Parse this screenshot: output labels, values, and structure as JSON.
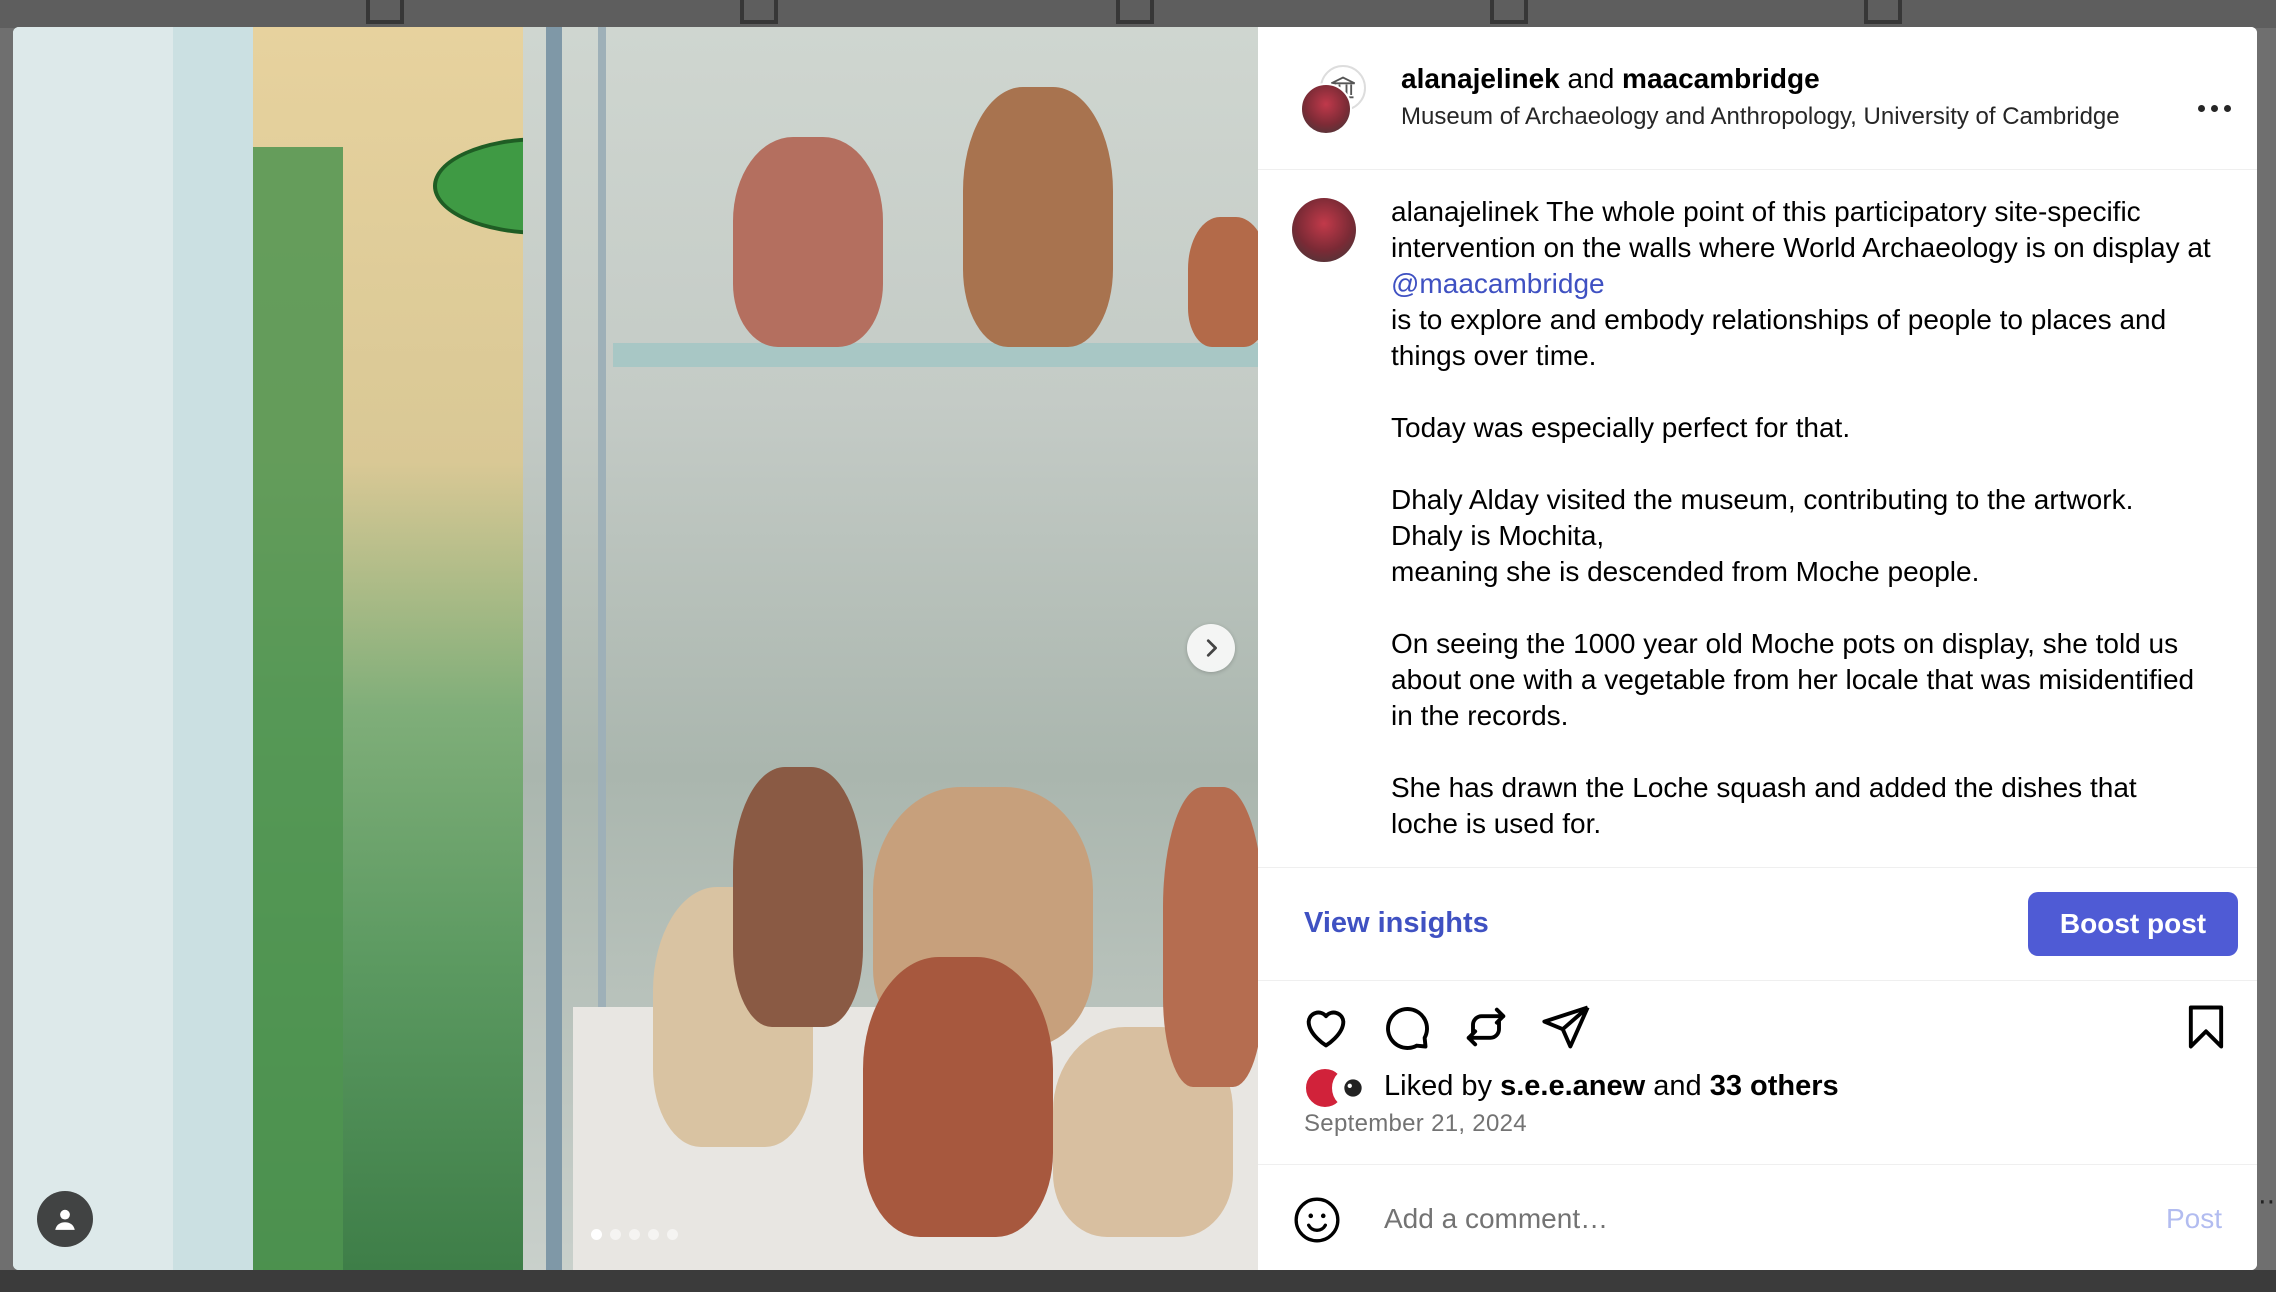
{
  "post": {
    "header": {
      "user1": "alanajelinek",
      "and": "and",
      "user2": "maacambridge",
      "location": "Museum of Archaeology and Anthropology, University of Cambridge"
    },
    "caption": {
      "username": "alanajelinek",
      "p1_a": "The whole point of this participatory site-specific intervention on the walls where World Archaeology is on display at",
      "mention": "@maacambridge",
      "p1_b": "is to explore and embody relationships of people to places and things over time.",
      "p2": "Today was especially perfect for that.",
      "p3_a": "Dhaly Alday visited the museum, contributing to the artwork.",
      "p3_b": "Dhaly is Mochita,",
      "p3_c": "meaning she is descended from Moche people.",
      "p4": "On seeing the 1000 year old Moche pots on display, she told us about one with a vegetable from her locale that was misidentified in the records.",
      "p5": "She has drawn the Loche squash and added the dishes that loche is used for."
    },
    "insights_label": "View insights",
    "boost_label": "Boost post",
    "likes": {
      "prefix": "Liked by",
      "user": "s.e.e.anew",
      "and": "and",
      "others": "33 others"
    },
    "date": "September 21, 2024",
    "comment": {
      "placeholder": "Add a comment…",
      "post_label": "Post"
    },
    "carousel": {
      "count": 5,
      "active": 0
    }
  },
  "colors": {
    "accent": "#4f5bd5",
    "link": "#3f51c2",
    "post_disabled": "#b2bcf0",
    "secondary_text": "#737373"
  },
  "icons": [
    "heart-icon",
    "comment-icon",
    "repost-icon",
    "share-icon",
    "bookmark-icon",
    "emoji-icon",
    "chevron-right-icon",
    "user-tag-icon",
    "more-icon"
  ]
}
